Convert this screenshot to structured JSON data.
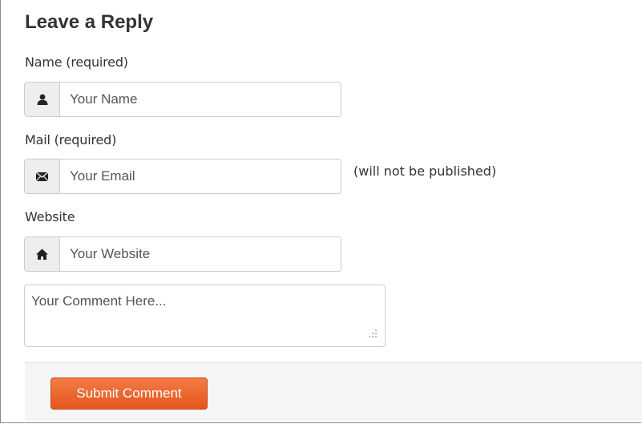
{
  "form": {
    "title": "Leave a Reply",
    "name": {
      "label": "Name (required)",
      "placeholder": "Your Name",
      "value": "",
      "icon": "user-icon"
    },
    "mail": {
      "label": "Mail (required)",
      "placeholder": "Your Email",
      "value": "",
      "icon": "envelope-icon",
      "note": "(will not be published)"
    },
    "website": {
      "label": "Website",
      "placeholder": "Your Website",
      "value": "",
      "icon": "home-icon"
    },
    "comment": {
      "placeholder": "Your Comment Here...",
      "value": ""
    },
    "submit_label": "Submit Comment"
  },
  "colors": {
    "accent": "#e96328",
    "addon_bg": "#eeeeee",
    "footer_bg": "#f5f5f5",
    "border": "#cccccc"
  }
}
